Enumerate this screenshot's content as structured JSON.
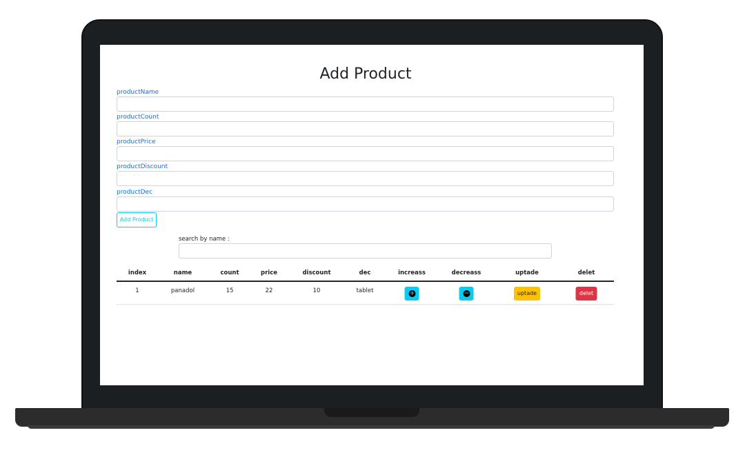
{
  "form": {
    "title": "Add Product",
    "fields": [
      {
        "label": "productName",
        "value": ""
      },
      {
        "label": "productCount",
        "value": ""
      },
      {
        "label": "productPrice",
        "value": ""
      },
      {
        "label": "productDiscount",
        "value": ""
      },
      {
        "label": "productDec",
        "value": ""
      }
    ],
    "submit_label": "Add Product"
  },
  "search": {
    "label": "search by name :",
    "value": ""
  },
  "table": {
    "headers": [
      "index",
      "name",
      "count",
      "price",
      "discount",
      "dec",
      "increass",
      "decreass",
      "uptade",
      "delet"
    ],
    "rows": [
      {
        "index": "1",
        "name": "panadol",
        "count": "15",
        "price": "22",
        "discount": "10",
        "dec": "tablet",
        "increase_icon": "plus-circle-icon",
        "decrease_icon": "minus-circle-icon",
        "update_label": "uptade",
        "delete_label": "delet"
      }
    ]
  },
  "colors": {
    "label_blue": "#0d6efd",
    "info": "#0dcaf0",
    "warning": "#ffc107",
    "danger": "#dc3545"
  }
}
